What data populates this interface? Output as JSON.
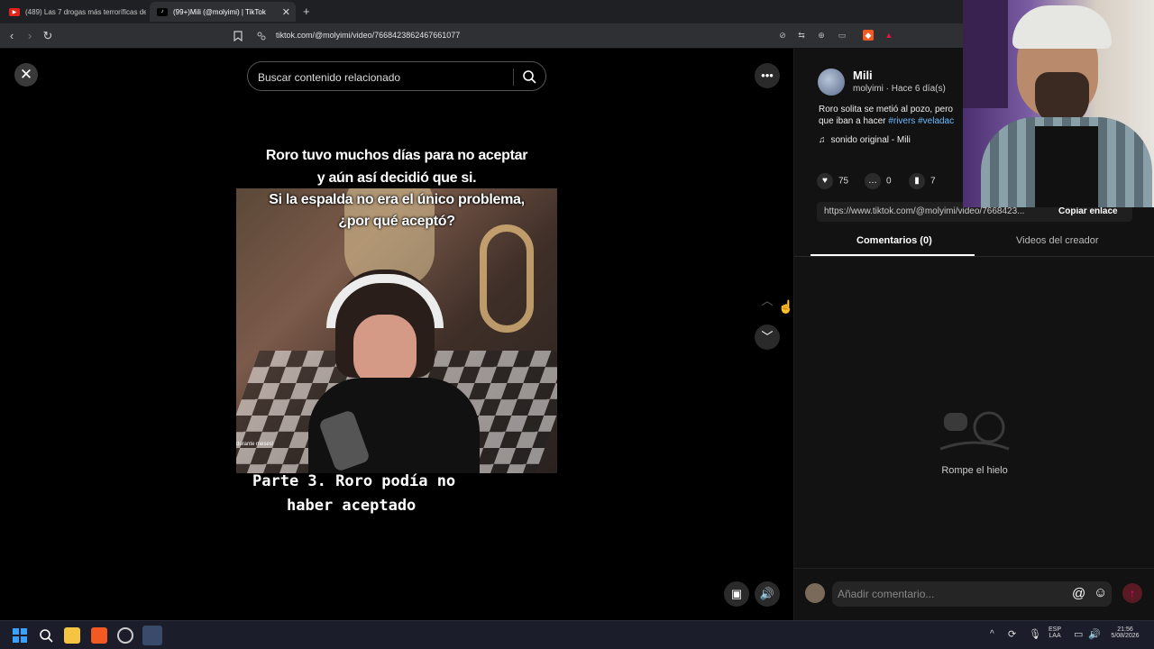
{
  "browser": {
    "tabs": [
      {
        "label": "(489) Las 7 drogas más terroríficas de",
        "favicon": "youtube-icon",
        "active": false
      },
      {
        "label": "(99+)Mili (@molyimi) | TikTok",
        "favicon": "tiktok-icon",
        "active": true
      }
    ],
    "new_tab": "+",
    "url": "tiktok.com/@molyimi/video/7668423862467661077"
  },
  "video": {
    "search_placeholder": "Buscar contenido relacionado",
    "caption_top_1": "Roro tuvo muchos días para no aceptar",
    "caption_top_2": "y aún así decidió que si.",
    "caption_top_3": "Si la espalda no era el único problema,",
    "caption_top_4": "¿por qué aceptó?",
    "caption_bottom_1": "Parte 3. Roro podía no",
    "caption_bottom_2": "haber aceptado",
    "frame_small_text": "durante   meses!"
  },
  "creator": {
    "name": "Mili",
    "handle_line": "molyimi · Hace 6 día(s)",
    "description": "Roro solita se metió al pozo, pero",
    "description_2": "que iban a hacer",
    "hashtag_1": "#rivers",
    "hashtag_2": "#veladac",
    "sound": "sonido original - Mili"
  },
  "stats": {
    "likes": "75",
    "comments": "0",
    "saves": "7"
  },
  "share": {
    "link": "https://www.tiktok.com/@molyimi/video/7668423...",
    "copy_label": "Copiar enlace"
  },
  "panel_tabs": {
    "comments": "Comentarios (0)",
    "creator_videos": "Videos del creador"
  },
  "empty_state": "Rompe el hielo",
  "comment_input": {
    "placeholder": "Añadir comentario..."
  },
  "taskbar": {
    "lang_1": "ESP",
    "lang_2": "LAA",
    "time": "21:56",
    "date": "5/08/2026"
  },
  "colors": {
    "accent": "#fe2c55",
    "link": "#6fb8ff",
    "panel_bg": "#121212"
  }
}
